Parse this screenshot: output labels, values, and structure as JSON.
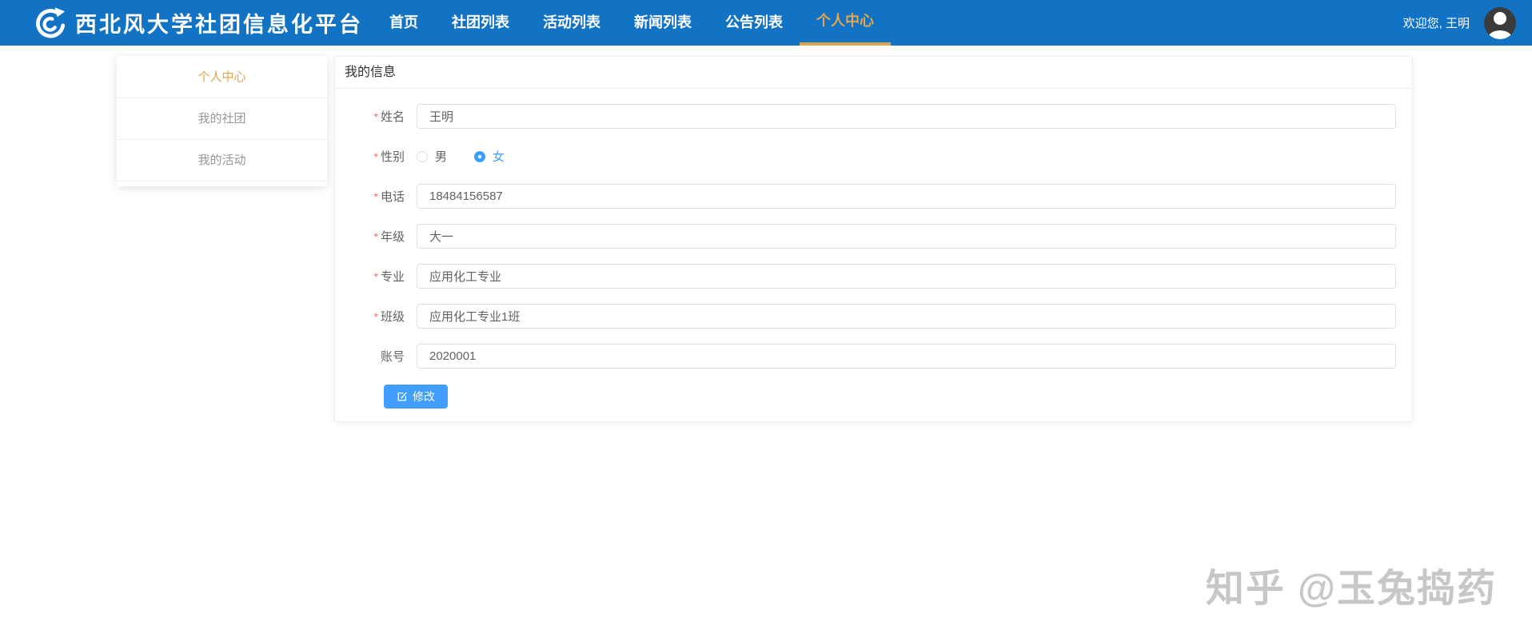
{
  "navbar": {
    "brand": "西北风大学社团信息化平台",
    "items": [
      {
        "label": "首页",
        "active": false
      },
      {
        "label": "社团列表",
        "active": false
      },
      {
        "label": "活动列表",
        "active": false
      },
      {
        "label": "新闻列表",
        "active": false
      },
      {
        "label": "公告列表",
        "active": false
      },
      {
        "label": "个人中心",
        "active": true
      }
    ],
    "welcome": "欢迎您, 王明"
  },
  "sidebar": {
    "items": [
      {
        "name": "personal-center",
        "label": "个人中心",
        "active": true
      },
      {
        "name": "my-clubs",
        "label": "我的社团",
        "active": false
      },
      {
        "name": "my-activities",
        "label": "我的活动",
        "active": false
      }
    ]
  },
  "main": {
    "title": "我的信息",
    "fields": [
      {
        "name": "name",
        "label": "姓名",
        "required": true,
        "type": "text",
        "value": "王明"
      },
      {
        "name": "gender",
        "label": "性别",
        "required": true,
        "type": "radio",
        "options": [
          "男",
          "女"
        ],
        "selected": "女"
      },
      {
        "name": "phone",
        "label": "电话",
        "required": true,
        "type": "text",
        "value": "18484156587"
      },
      {
        "name": "grade",
        "label": "年级",
        "required": true,
        "type": "text",
        "value": "大一"
      },
      {
        "name": "major",
        "label": "专业",
        "required": true,
        "type": "text",
        "value": "应用化工专业"
      },
      {
        "name": "class",
        "label": "班级",
        "required": true,
        "type": "text",
        "value": "应用化工专业1班"
      },
      {
        "name": "account",
        "label": "账号",
        "required": false,
        "type": "text",
        "value": "2020001"
      }
    ],
    "submit_label": "修改"
  },
  "watermark": "知乎 @玉兔捣药",
  "colors": {
    "navbar_bg": "#1273c4",
    "accent_gold": "#e0a44c",
    "primary_button": "#409eff",
    "required_star": "#f56c6c",
    "input_border": "#dcdfe6",
    "watermark_gray": "#c7c7c7",
    "avatar_bg": "#3b3b3b"
  }
}
